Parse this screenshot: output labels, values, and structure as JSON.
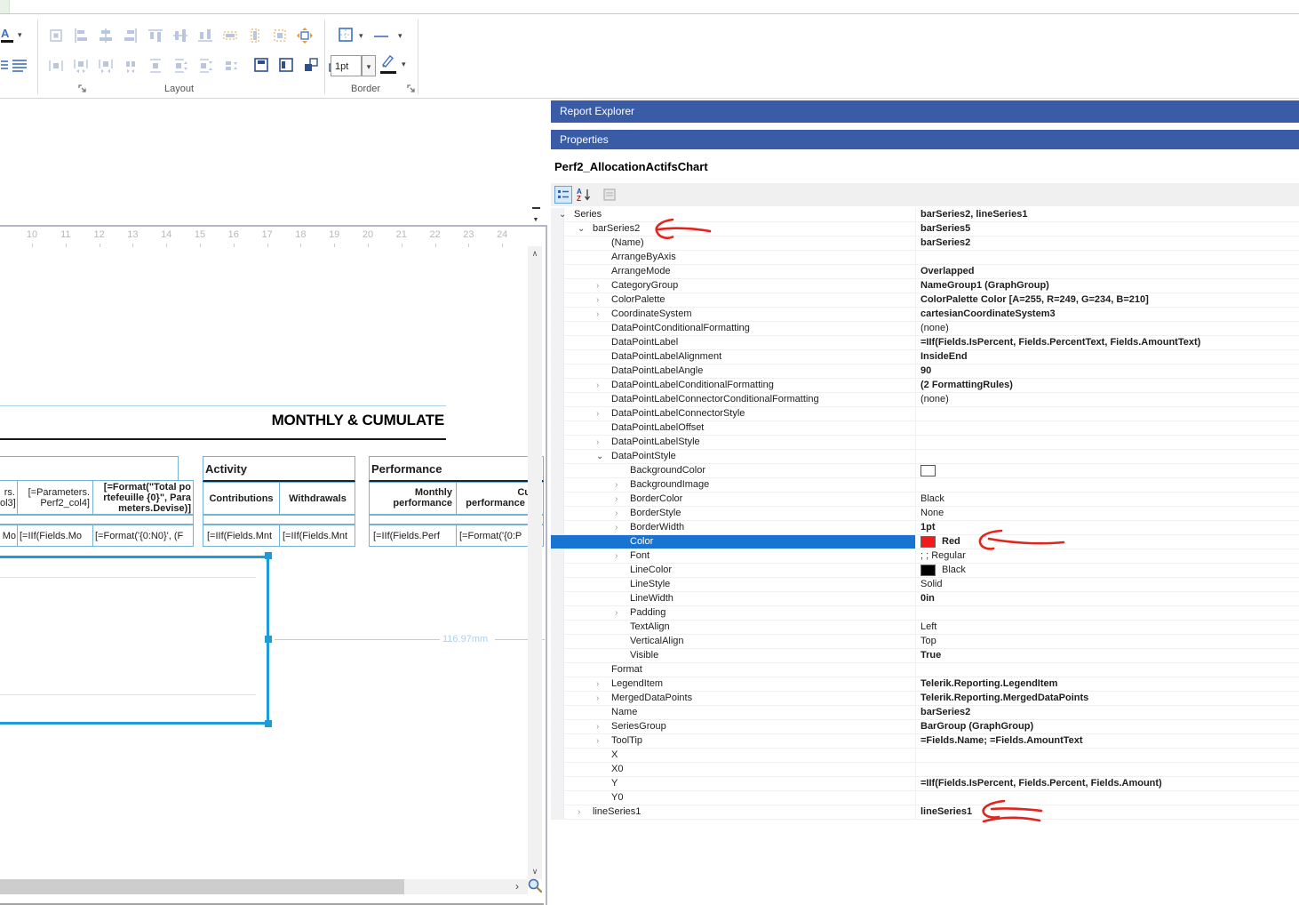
{
  "ribbon": {
    "layout_label": "Layout",
    "border_label": "Border",
    "border_width_value": "1pt"
  },
  "icons": {
    "caret_down": "▾",
    "overflow": "▼",
    "scroll_up": "∧",
    "scroll_down": "∨",
    "scroll_right": "›",
    "expander_collapsed": "›",
    "expander_expanded": "⌄",
    "font_color_letter": "A",
    "sort_a": "A",
    "sort_z": "Z"
  },
  "designer": {
    "ruler_numbers": [
      "10",
      "11",
      "12",
      "13",
      "14",
      "15",
      "16",
      "17",
      "18",
      "19",
      "20",
      "21",
      "22",
      "23",
      "24"
    ],
    "report_title": "MONTHLY & CUMULATE",
    "dimension_label": "116.97mm",
    "tables": {
      "left": {
        "header_cells": [
          "rs.\nol3]",
          "[=Parameters.\nPerf2_col4]",
          "[=Format(\"Total po\nrtefeuille {0}\", Para\nmeters.Devise)]"
        ],
        "data_cells": [
          "Mo",
          "[=IIf(Fields.Mo",
          "[=Format('{0:N0}', (F"
        ]
      },
      "activity": {
        "title": "Activity",
        "header_cells": [
          "Contributions",
          "Withdrawals"
        ],
        "data_cells": [
          "[=IIf(Fields.Mnt",
          "[=IIf(Fields.Mnt"
        ]
      },
      "performance": {
        "title": "Performance",
        "header_cells": [
          "Monthly\nperformance",
          "Cu\nperformance i"
        ],
        "data_cells": [
          "[=IIf(Fields.Perf",
          "[=Format('{0:P"
        ]
      }
    }
  },
  "properties_panel": {
    "explorer_title": "Report Explorer",
    "properties_title": "Properties",
    "object_name": "Perf2_AllocationActifsChart",
    "selected_row_color": "#1873d3",
    "titlebar_color": "#3a5ba5",
    "annotation_color": "#e2251c",
    "annotations": [
      "arrow-to-barSeries2",
      "arrow-to-color-red",
      "arrow-to-lineSeries1"
    ],
    "grid_rows": [
      {
        "i": 0,
        "e": 2,
        "n": "Series",
        "v": "barSeries2, lineSeries1",
        "b": 1
      },
      {
        "i": 1,
        "e": 2,
        "n": "barSeries2",
        "v": "barSeries5",
        "b": 1
      },
      {
        "i": 2,
        "e": 0,
        "n": "(Name)",
        "v": "barSeries2",
        "b": 1
      },
      {
        "i": 2,
        "e": 0,
        "n": "ArrangeByAxis",
        "v": ""
      },
      {
        "i": 2,
        "e": 0,
        "n": "ArrangeMode",
        "v": "Overlapped",
        "b": 1
      },
      {
        "i": 2,
        "e": 1,
        "n": "CategoryGroup",
        "v": "NameGroup1 (GraphGroup)",
        "b": 1
      },
      {
        "i": 2,
        "e": 1,
        "n": "ColorPalette",
        "v": "ColorPalette Color [A=255, R=249, G=234, B=210]",
        "b": 1
      },
      {
        "i": 2,
        "e": 1,
        "n": "CoordinateSystem",
        "v": "cartesianCoordinateSystem3",
        "b": 1
      },
      {
        "i": 2,
        "e": 0,
        "n": "DataPointConditionalFormatting",
        "v": "(none)"
      },
      {
        "i": 2,
        "e": 0,
        "n": "DataPointLabel",
        "v": "=IIf(Fields.IsPercent, Fields.PercentText, Fields.AmountText)",
        "b": 1
      },
      {
        "i": 2,
        "e": 0,
        "n": "DataPointLabelAlignment",
        "v": "InsideEnd",
        "b": 1
      },
      {
        "i": 2,
        "e": 0,
        "n": "DataPointLabelAngle",
        "v": "90",
        "b": 1
      },
      {
        "i": 2,
        "e": 1,
        "n": "DataPointLabelConditionalFormatting",
        "v": "(2 FormattingRules)",
        "b": 1
      },
      {
        "i": 2,
        "e": 0,
        "n": "DataPointLabelConnectorConditionalFormatting",
        "v": "(none)"
      },
      {
        "i": 2,
        "e": 1,
        "n": "DataPointLabelConnectorStyle",
        "v": ""
      },
      {
        "i": 2,
        "e": 0,
        "n": "DataPointLabelOffset",
        "v": ""
      },
      {
        "i": 2,
        "e": 1,
        "n": "DataPointLabelStyle",
        "v": ""
      },
      {
        "i": 2,
        "e": 2,
        "n": "DataPointStyle",
        "v": ""
      },
      {
        "i": 3,
        "e": 0,
        "n": "BackgroundColor",
        "v": "",
        "s": "#ffffff"
      },
      {
        "i": 3,
        "e": 1,
        "n": "BackgroundImage",
        "v": ""
      },
      {
        "i": 3,
        "e": 1,
        "n": "BorderColor",
        "v": "Black"
      },
      {
        "i": 3,
        "e": 1,
        "n": "BorderStyle",
        "v": "None"
      },
      {
        "i": 3,
        "e": 1,
        "n": "BorderWidth",
        "v": "1pt",
        "b": 1
      },
      {
        "i": 3,
        "e": 0,
        "n": "Color",
        "v": "Red",
        "b": 1,
        "s": "#ee1c1c",
        "sel": 1
      },
      {
        "i": 3,
        "e": 1,
        "n": "Font",
        "v": "; ; Regular"
      },
      {
        "i": 3,
        "e": 0,
        "n": "LineColor",
        "v": "Black",
        "s": "#000000"
      },
      {
        "i": 3,
        "e": 0,
        "n": "LineStyle",
        "v": "Solid"
      },
      {
        "i": 3,
        "e": 0,
        "n": "LineWidth",
        "v": "0in",
        "b": 1
      },
      {
        "i": 3,
        "e": 1,
        "n": "Padding",
        "v": ""
      },
      {
        "i": 3,
        "e": 0,
        "n": "TextAlign",
        "v": "Left"
      },
      {
        "i": 3,
        "e": 0,
        "n": "VerticalAlign",
        "v": "Top"
      },
      {
        "i": 3,
        "e": 0,
        "n": "Visible",
        "v": "True",
        "b": 1
      },
      {
        "i": 2,
        "e": 0,
        "n": "Format",
        "v": ""
      },
      {
        "i": 2,
        "e": 1,
        "n": "LegendItem",
        "v": "Telerik.Reporting.LegendItem",
        "b": 1
      },
      {
        "i": 2,
        "e": 1,
        "n": "MergedDataPoints",
        "v": "Telerik.Reporting.MergedDataPoints",
        "b": 1
      },
      {
        "i": 2,
        "e": 0,
        "n": "Name",
        "v": "barSeries2",
        "b": 1
      },
      {
        "i": 2,
        "e": 1,
        "n": "SeriesGroup",
        "v": "BarGroup (GraphGroup)",
        "b": 1
      },
      {
        "i": 2,
        "e": 1,
        "n": "ToolTip",
        "v": "=Fields.Name; =Fields.AmountText",
        "b": 1
      },
      {
        "i": 2,
        "e": 0,
        "n": "X",
        "v": ""
      },
      {
        "i": 2,
        "e": 0,
        "n": "X0",
        "v": ""
      },
      {
        "i": 2,
        "e": 0,
        "n": "Y",
        "v": "=IIf(Fields.IsPercent, Fields.Percent, Fields.Amount)",
        "b": 1
      },
      {
        "i": 2,
        "e": 0,
        "n": "Y0",
        "v": ""
      },
      {
        "i": 1,
        "e": 1,
        "n": "lineSeries1",
        "v": "lineSeries1",
        "b": 1
      }
    ]
  }
}
